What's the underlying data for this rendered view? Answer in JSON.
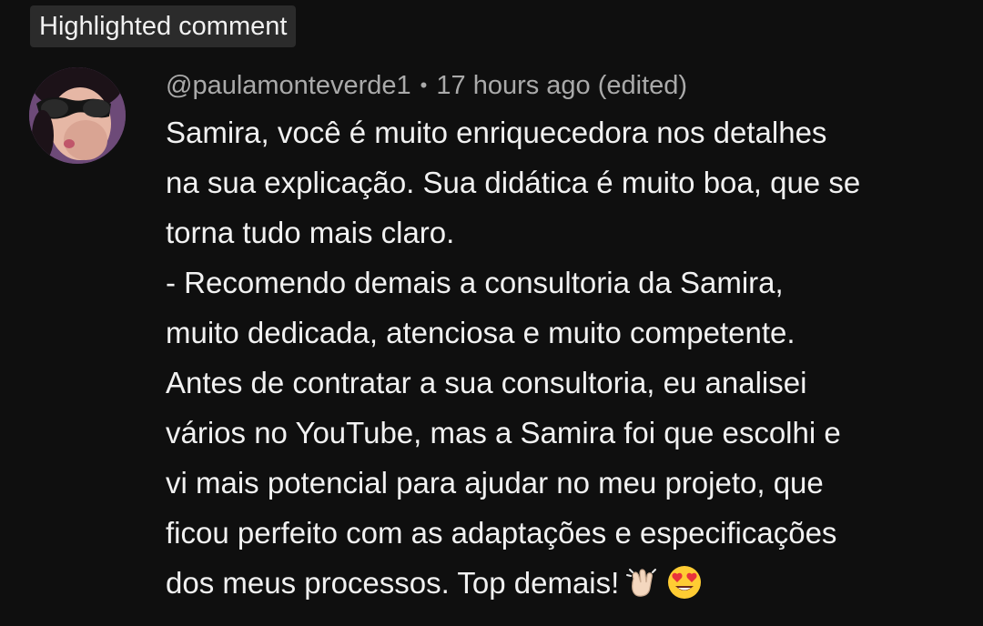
{
  "badge": {
    "label": "Highlighted comment"
  },
  "comment": {
    "author": "@paulamonteverde1",
    "separator": "•",
    "timestamp": "17 hours ago (edited)",
    "lines": [
      "Samira, você é muito enriquecedora nos detalhes",
      "na sua explicação. Sua didática é muito boa, que se",
      "torna tudo mais claro.",
      "- Recomendo demais a consultoria da Samira,",
      "muito dedicada, atenciosa e muito competente.",
      "Antes de contratar a sua consultoria, eu analisei",
      "vários no YouTube, mas a Samira foi que escolhi e",
      "vi mais potencial para ajudar no meu projeto, que",
      "ficou perfeito com as adaptações e especificações",
      "dos meus processos. Top demais!"
    ],
    "emojis": [
      "clapping-hands-emoji",
      "heart-eyes-emoji"
    ]
  },
  "colors": {
    "background": "#0f0f0f",
    "badge_bg": "#2b2b2b",
    "text_primary": "#f1f1f1",
    "text_secondary": "#aaaaaa"
  }
}
